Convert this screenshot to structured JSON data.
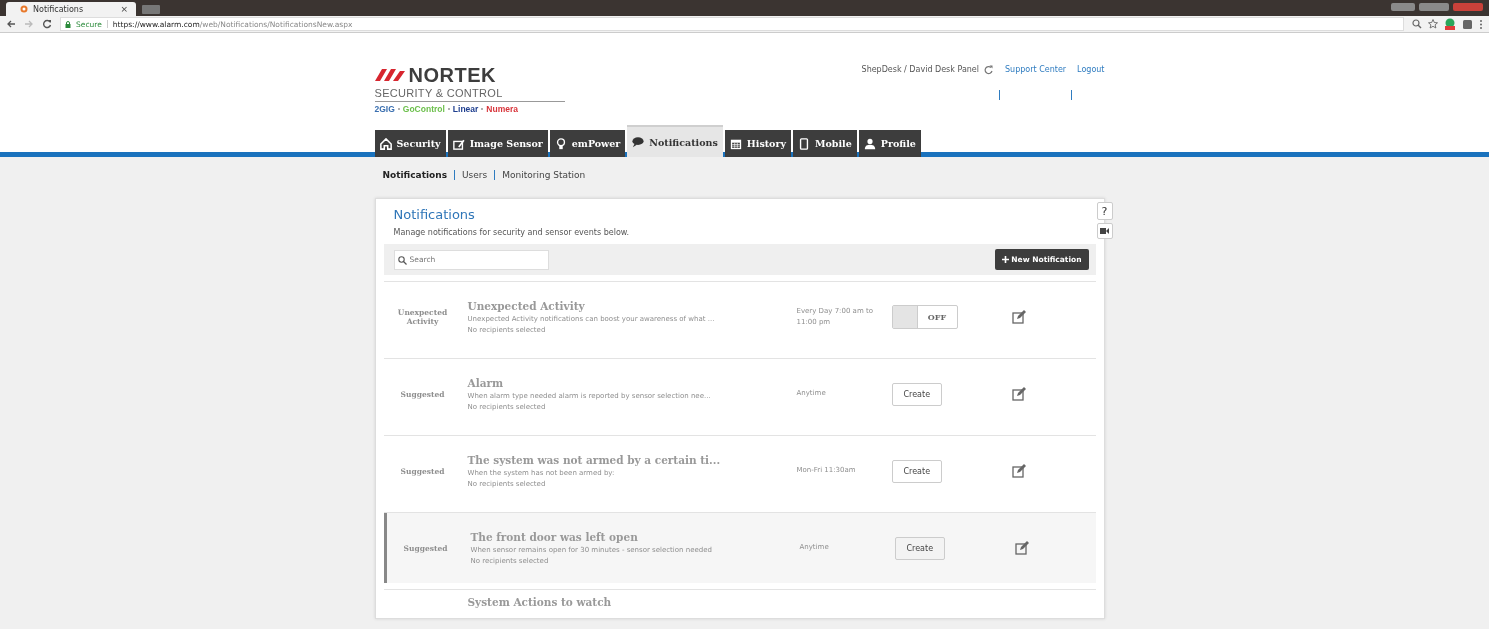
{
  "browser": {
    "tab_title": "Notifications",
    "tab_close": "×",
    "secure_label": "Secure",
    "url_host": "https://www.alarm.com",
    "url_path": "/web/Notifications/NotificationsNew.aspx"
  },
  "header": {
    "logo_name": "NORTEK",
    "logo_tagline": "SECURITY & CONTROL",
    "brands": [
      {
        "name": "2GIG",
        "color": "#3a6fb0"
      },
      {
        "name": "GoControl",
        "color": "#6bbf4a"
      },
      {
        "name": "Linear",
        "color": "#1f3f8f"
      },
      {
        "name": "Numera",
        "color": "#d8343a"
      }
    ],
    "account": "ShepDesk / David Desk Panel",
    "links": [
      "Support Center",
      "Logout"
    ]
  },
  "tabs": [
    {
      "label": "Security",
      "selected": false
    },
    {
      "label": "Image Sensor",
      "selected": false
    },
    {
      "label": "emPower",
      "selected": false
    },
    {
      "label": "Notifications",
      "selected": true
    },
    {
      "label": "History",
      "selected": false
    },
    {
      "label": "Mobile",
      "selected": false
    },
    {
      "label": "Profile",
      "selected": false
    }
  ],
  "subnav": [
    {
      "label": "Notifications",
      "selected": true
    },
    {
      "label": "Users",
      "selected": false
    },
    {
      "label": "Monitoring Station",
      "selected": false
    }
  ],
  "card": {
    "title": "Notifications",
    "description": "Manage notifications for security and sensor events below.",
    "search": {
      "placeholder": "Search"
    },
    "new_button": "New Notification"
  },
  "help": {
    "label": "?"
  },
  "rows": [
    {
      "kind": "toggle",
      "category": "Unexpected Activity",
      "title": "Unexpected Activity",
      "description": "Unexpected Activity notifications can boost your awareness of what ...",
      "recipients": "No recipients selected",
      "schedule": "Every Day 7:00 am to 11:00 pm",
      "control": "OFF",
      "on": false,
      "hovered": false
    },
    {
      "kind": "create",
      "category": "Suggested",
      "title": "Alarm",
      "description": "When alarm type needed alarm is reported by sensor selection nee...",
      "recipients": "No recipients selected",
      "schedule": "Anytime",
      "control": "Create",
      "hovered": false
    },
    {
      "kind": "create",
      "category": "Suggested",
      "title": "The system was not armed by a certain ti...",
      "description": "When the system has not been armed by:",
      "recipients": "No recipients selected",
      "schedule": "Mon-Fri 11:30am",
      "control": "Create",
      "hovered": false
    },
    {
      "kind": "create",
      "category": "Suggested",
      "title": "The front door was left open",
      "description": "When sensor remains open for 30 minutes - sensor selection needed",
      "recipients": "No recipients selected",
      "schedule": "Anytime",
      "control": "Create",
      "hovered": true
    },
    {
      "kind": "partial",
      "title": "System Actions to watch",
      "hovered": false
    }
  ]
}
